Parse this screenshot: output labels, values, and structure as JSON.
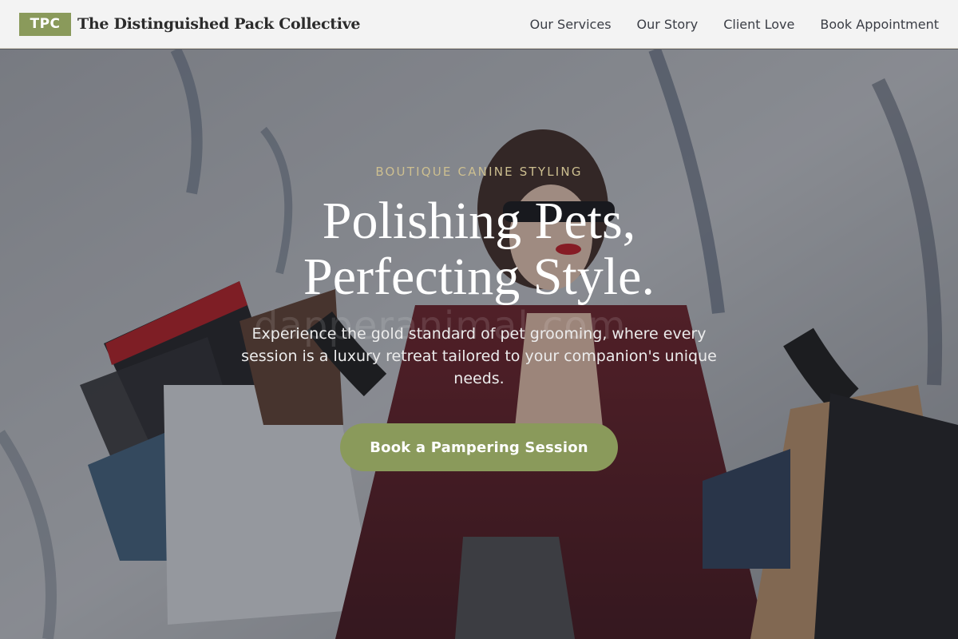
{
  "header": {
    "logo_badge": "TPC",
    "brand_name": "The Distinguished Pack Collective",
    "nav": [
      {
        "label": "Our Services"
      },
      {
        "label": "Our Story"
      },
      {
        "label": "Client Love"
      },
      {
        "label": "Book Appointment"
      }
    ]
  },
  "hero": {
    "eyebrow": "BOUTIQUE CANINE STYLING",
    "headline_line1": "Polishing Pets,",
    "headline_line2": "Perfecting Style.",
    "subtext": "Experience the gold standard of pet grooming, where every session is a luxury retreat tailored to your companion's unique needs.",
    "cta_label": "Book a Pampering Session",
    "watermark": "dapperanimal.com"
  },
  "colors": {
    "accent": "#8a9a5b",
    "eyebrow": "#cdbf90",
    "header_bg": "#f3f3f3"
  }
}
